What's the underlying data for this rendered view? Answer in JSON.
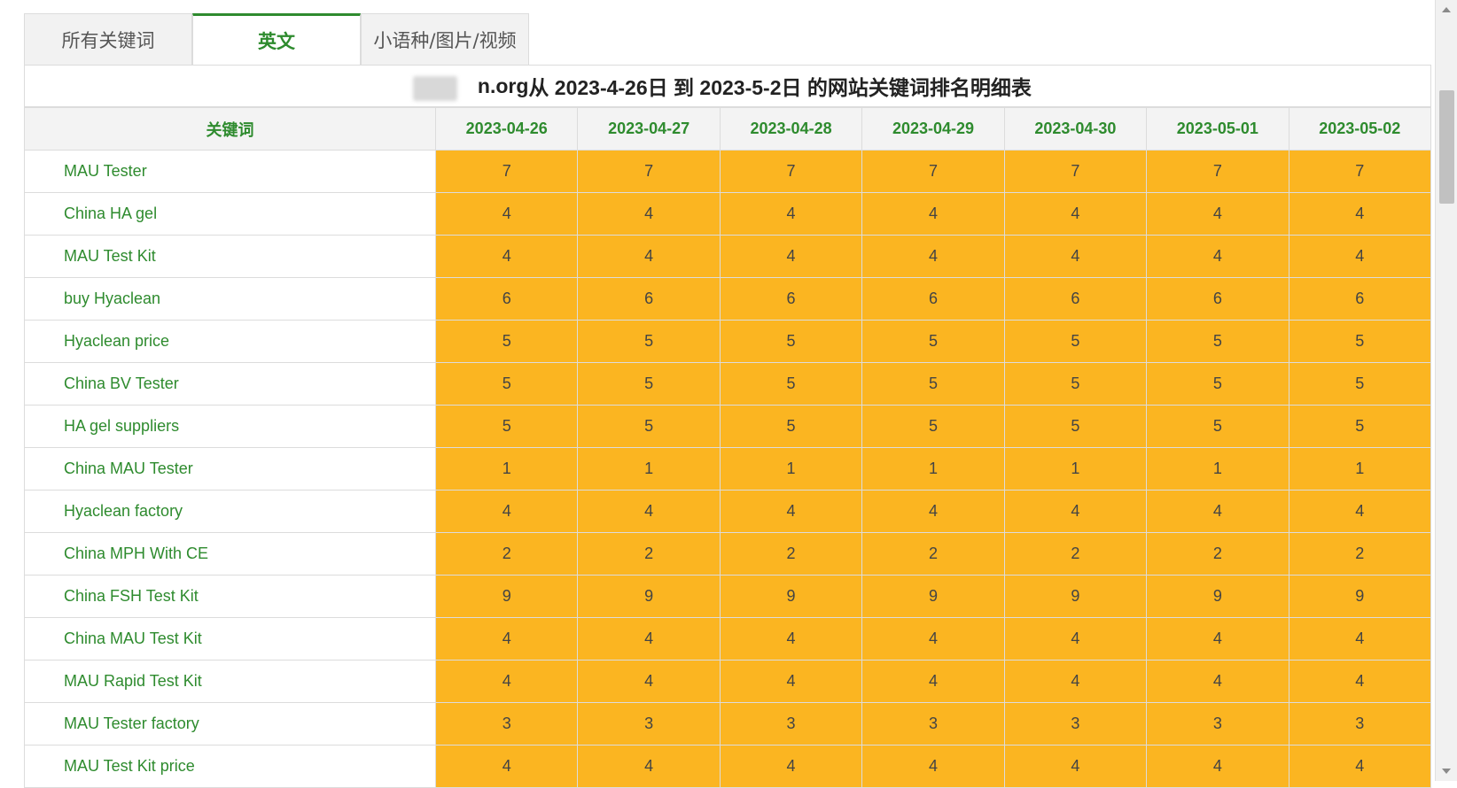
{
  "tabs": [
    {
      "label": "所有关键词",
      "active": false
    },
    {
      "label": "英文",
      "active": true
    },
    {
      "label": "小语种/图片/视频",
      "active": false
    }
  ],
  "caption": {
    "prefix": "s",
    "domain_suffix": "n.org",
    "text": " 从 2023-4-26日 到 2023-5-2日 的网站关键词排名明细表"
  },
  "table": {
    "keyword_header": "关键词",
    "dates": [
      "2023-04-26",
      "2023-04-27",
      "2023-04-28",
      "2023-04-29",
      "2023-04-30",
      "2023-05-01",
      "2023-05-02"
    ],
    "rows": [
      {
        "keyword": "MAU Tester",
        "ranks": [
          "7",
          "7",
          "7",
          "7",
          "7",
          "7",
          "7"
        ]
      },
      {
        "keyword": "China HA gel",
        "ranks": [
          "4",
          "4",
          "4",
          "4",
          "4",
          "4",
          "4"
        ]
      },
      {
        "keyword": "MAU Test Kit",
        "ranks": [
          "4",
          "4",
          "4",
          "4",
          "4",
          "4",
          "4"
        ]
      },
      {
        "keyword": "buy Hyaclean",
        "ranks": [
          "6",
          "6",
          "6",
          "6",
          "6",
          "6",
          "6"
        ]
      },
      {
        "keyword": "Hyaclean price",
        "ranks": [
          "5",
          "5",
          "5",
          "5",
          "5",
          "5",
          "5"
        ]
      },
      {
        "keyword": "China BV Tester",
        "ranks": [
          "5",
          "5",
          "5",
          "5",
          "5",
          "5",
          "5"
        ]
      },
      {
        "keyword": "HA gel suppliers",
        "ranks": [
          "5",
          "5",
          "5",
          "5",
          "5",
          "5",
          "5"
        ]
      },
      {
        "keyword": "China MAU Tester",
        "ranks": [
          "1",
          "1",
          "1",
          "1",
          "1",
          "1",
          "1"
        ]
      },
      {
        "keyword": "Hyaclean factory",
        "ranks": [
          "4",
          "4",
          "4",
          "4",
          "4",
          "4",
          "4"
        ]
      },
      {
        "keyword": "China MPH With CE",
        "ranks": [
          "2",
          "2",
          "2",
          "2",
          "2",
          "2",
          "2"
        ]
      },
      {
        "keyword": "China FSH Test Kit",
        "ranks": [
          "9",
          "9",
          "9",
          "9",
          "9",
          "9",
          "9"
        ]
      },
      {
        "keyword": "China MAU Test Kit",
        "ranks": [
          "4",
          "4",
          "4",
          "4",
          "4",
          "4",
          "4"
        ]
      },
      {
        "keyword": "MAU Rapid Test Kit",
        "ranks": [
          "4",
          "4",
          "4",
          "4",
          "4",
          "4",
          "4"
        ]
      },
      {
        "keyword": "MAU Tester factory",
        "ranks": [
          "3",
          "3",
          "3",
          "3",
          "3",
          "3",
          "3"
        ]
      },
      {
        "keyword": "MAU Test Kit price",
        "ranks": [
          "4",
          "4",
          "4",
          "4",
          "4",
          "4",
          "4"
        ]
      }
    ]
  },
  "colors": {
    "accent_green": "#2e8b2e",
    "rank_cell_bg": "#fbb521"
  }
}
